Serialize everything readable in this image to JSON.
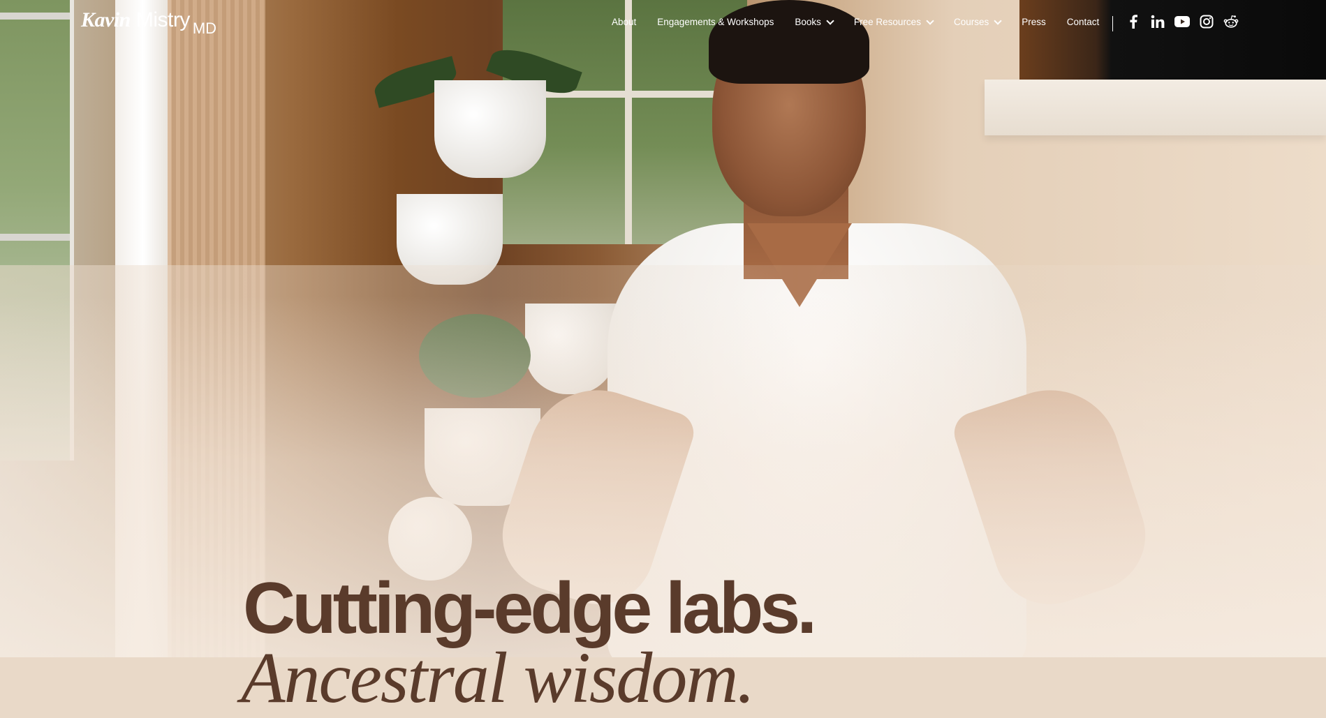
{
  "header": {
    "logo": {
      "first": "Kavin",
      "last": "Mistry",
      "suffix": "MD"
    },
    "nav": [
      {
        "label": "About",
        "has_dropdown": false
      },
      {
        "label": "Engagements & Workshops",
        "has_dropdown": false
      },
      {
        "label": "Books",
        "has_dropdown": true
      },
      {
        "label": "Free Resources",
        "has_dropdown": true
      },
      {
        "label": "Courses",
        "has_dropdown": true
      },
      {
        "label": "Press",
        "has_dropdown": false
      },
      {
        "label": "Contact",
        "has_dropdown": false
      }
    ],
    "socials": [
      "facebook-icon",
      "linkedin-icon",
      "youtube-icon",
      "instagram-icon",
      "reddit-icon"
    ]
  },
  "hero": {
    "title": "Cutting-edge labs.",
    "subtitle": "Ancestral wisdom."
  },
  "colors": {
    "nav_text": "#ffffff",
    "heading": "#5a3b2b"
  }
}
